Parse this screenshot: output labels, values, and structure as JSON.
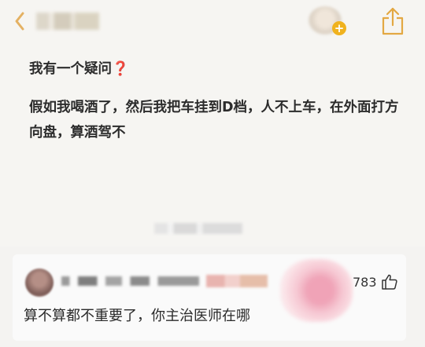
{
  "post": {
    "title": "我有一个疑问",
    "title_mark": "❓",
    "body": "假如我喝酒了，然后我把车挂到D档，人不上车，在外面打方向盘，算酒驾不"
  },
  "comment": {
    "like_count": "783",
    "text": "算不算都不重要了，你主治医师在哪"
  },
  "icons": {
    "back": "chevron-left-icon",
    "add": "plus-badge-icon",
    "share": "share-icon",
    "like": "thumbs-up-icon"
  },
  "colors": {
    "accent": "#f0b21e",
    "question_mark": "#d8312a",
    "text": "#2c2c2c"
  }
}
